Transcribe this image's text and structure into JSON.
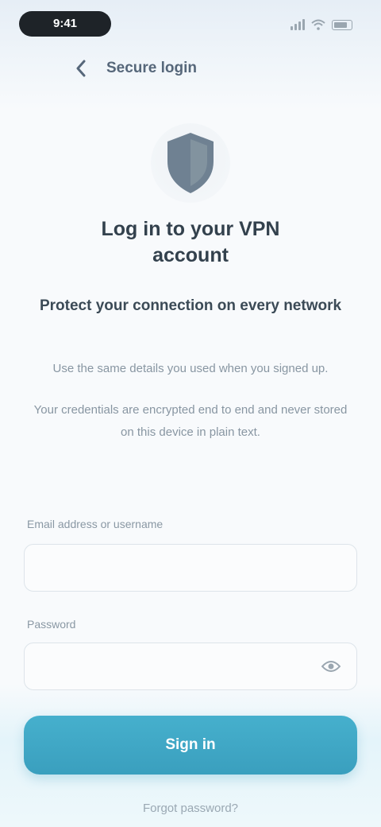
{
  "status_bar": {
    "time": "9:41",
    "icons": [
      "signal-icon",
      "wifi-icon",
      "battery-icon"
    ]
  },
  "header": {
    "back_icon": "chevron-left-icon",
    "title": "Secure login"
  },
  "hero": {
    "icon": "shield-icon",
    "title": "Log in to your VPN account",
    "subtitle": "Protect your connection on every network",
    "description": "Use the same details you used when you signed up.",
    "note": "Your credentials are encrypted end to end and never stored on this device in plain text."
  },
  "form": {
    "username": {
      "label": "Email address or username",
      "value": ""
    },
    "password": {
      "label": "Password",
      "value": "",
      "toggle_icon": "eye-icon"
    },
    "submit_label": "Sign in"
  },
  "footer": {
    "help_link": "Forgot password?"
  },
  "colors": {
    "accent": "#3ea6c4",
    "text_primary": "#33414d",
    "text_secondary": "#8896a2",
    "shield": "#6f8192"
  }
}
